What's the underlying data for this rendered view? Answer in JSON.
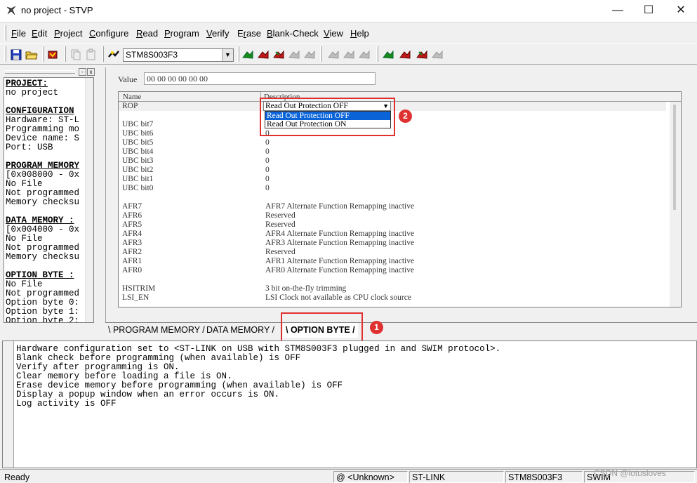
{
  "window": {
    "title": "no project - STVP",
    "minimize": "—",
    "maximize": "☐",
    "close": "✕"
  },
  "menu": [
    {
      "pre": "",
      "ul": "F",
      "post": "ile"
    },
    {
      "pre": "",
      "ul": "E",
      "post": "dit"
    },
    {
      "pre": "",
      "ul": "P",
      "post": "roject"
    },
    {
      "pre": "",
      "ul": "C",
      "post": "onfigure"
    },
    {
      "pre": "",
      "ul": "R",
      "post": "ead"
    },
    {
      "pre": "",
      "ul": "P",
      "post": "rogram"
    },
    {
      "pre": "",
      "ul": "V",
      "post": "erify"
    },
    {
      "pre": "E",
      "ul": "r",
      "post": "ase"
    },
    {
      "pre": "",
      "ul": "B",
      "post": "lank-Check"
    },
    {
      "pre": "",
      "ul": "V",
      "post": "iew"
    },
    {
      "pre": "",
      "ul": "H",
      "post": "elp"
    }
  ],
  "toolbar": {
    "device": "STM8S003F3"
  },
  "left_panel": {
    "sections": [
      {
        "title": "PROJECT:",
        "lines": [
          "no project"
        ]
      },
      {
        "title": "CONFIGURATION",
        "lines": [
          "Hardware: ST-L",
          "Programming mo",
          "Device name: S",
          "Port: USB"
        ]
      },
      {
        "title": "PROGRAM MEMORY",
        "lines": [
          "[0x008000 - 0x",
          "No File",
          "Not programmed",
          "Memory checksu"
        ]
      },
      {
        "title": "DATA MEMORY :",
        "lines": [
          "[0x004000 - 0x",
          "No File",
          "Not programmed",
          "Memory checksu"
        ]
      },
      {
        "title": "OPTION BYTE :",
        "lines": [
          "No File",
          "Not programmed",
          "Option byte 0:",
          "Option byte 1:",
          "Option byte 2:"
        ]
      }
    ]
  },
  "main": {
    "value_label": "Value",
    "value": "00 00 00 00 00 00",
    "columns": {
      "name": "Name",
      "description": "Description"
    },
    "rows": [
      {
        "name": "ROP",
        "desc": ""
      },
      {
        "name": "UBC bit7",
        "desc": "0"
      },
      {
        "name": "UBC bit6",
        "desc": "0"
      },
      {
        "name": "UBC bit5",
        "desc": "0"
      },
      {
        "name": "UBC bit4",
        "desc": "0"
      },
      {
        "name": "UBC bit3",
        "desc": "0"
      },
      {
        "name": "UBC bit2",
        "desc": "0"
      },
      {
        "name": "UBC bit1",
        "desc": "0"
      },
      {
        "name": "UBC bit0",
        "desc": "0"
      },
      {
        "name": "",
        "desc": ""
      },
      {
        "name": "AFR7",
        "desc": "AFR7 Alternate Function Remapping inactive"
      },
      {
        "name": "AFR6",
        "desc": "Reserved"
      },
      {
        "name": "AFR5",
        "desc": "Reserved"
      },
      {
        "name": "AFR4",
        "desc": "AFR4 Alternate Function Remapping inactive"
      },
      {
        "name": "AFR3",
        "desc": "AFR3 Alternate Function Remapping inactive"
      },
      {
        "name": "AFR2",
        "desc": "Reserved"
      },
      {
        "name": "AFR1",
        "desc": "AFR1 Alternate Function Remapping inactive"
      },
      {
        "name": "AFR0",
        "desc": "AFR0 Alternate Function Remapping inactive"
      },
      {
        "name": "",
        "desc": ""
      },
      {
        "name": "HSITRIM",
        "desc": "3 bit on-the-fly trimming"
      },
      {
        "name": "LSI_EN",
        "desc": "LSI Clock not available as CPU clock source"
      }
    ],
    "rop_dropdown": {
      "selected": "Read Out Protection OFF",
      "options": [
        "Read Out Protection OFF",
        "Read Out Protection ON"
      ]
    }
  },
  "tabs": [
    "PROGRAM MEMORY",
    "DATA MEMORY",
    "OPTION BYTE"
  ],
  "active_tab": "OPTION BYTE",
  "annotations": {
    "badge1": "1",
    "badge2": "2",
    "color": "#e03131"
  },
  "log": [
    "Hardware configuration set to <ST-LINK on USB with STM8S003F3 plugged in and SWIM protocol>.",
    "Blank check before programming (when available) is OFF",
    "Verify after programming is ON.",
    "Clear memory before loading a file is ON.",
    "Erase device memory before programming (when available) is OFF",
    "Display a popup window when an error occurs is ON.",
    "Log activity is OFF"
  ],
  "status": {
    "ready": "Ready",
    "address": "@ <Unknown>",
    "programmer": "ST-LINK",
    "device": "STM8S003F3",
    "protocol": "SWIM"
  },
  "watermark": "CSDN @lotusloves"
}
